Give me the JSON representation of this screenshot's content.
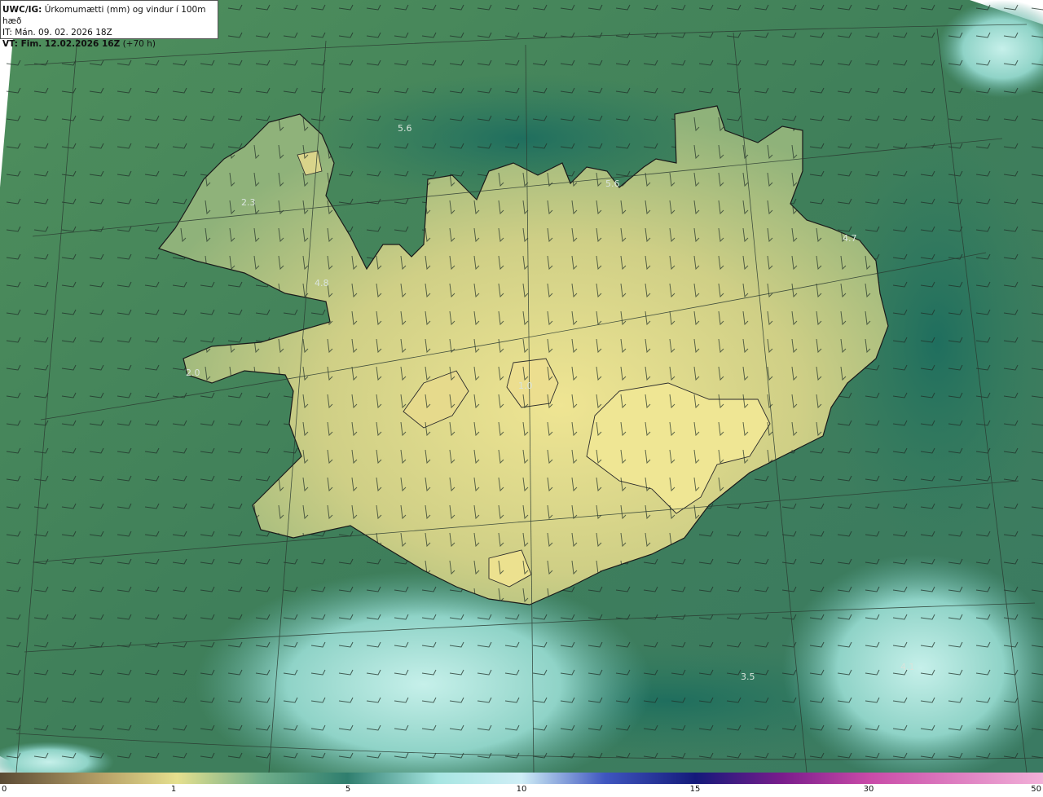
{
  "header": {
    "product": "UWC/IG:",
    "parameter": "Úrkomumætti (mm) og vindur í 100m hæð",
    "initial_time": "IT: Mán. 09. 02. 2026 18Z",
    "valid_prefix": "VT: Fim. 12.02.2026 16Z",
    "valid_suffix": "(+70 h)"
  },
  "map_labels": [
    {
      "id": "label-5-6-north",
      "text": "5.6"
    },
    {
      "id": "label-5-6-northeast",
      "text": "5.6"
    },
    {
      "id": "label-2-3",
      "text": "2.3"
    },
    {
      "id": "label-4-7",
      "text": "4.7"
    },
    {
      "id": "label-4-8",
      "text": "4.8"
    },
    {
      "id": "label-2-0",
      "text": "2.0"
    },
    {
      "id": "label-1-0",
      "text": "1.0"
    },
    {
      "id": "label-3-5",
      "text": "3.5"
    },
    {
      "id": "label-4-1",
      "text": "4.1"
    }
  ],
  "colorbar": {
    "ticks": [
      "0",
      "1",
      "5",
      "10",
      "15",
      "30",
      "50"
    ],
    "colors": [
      "#5a4a34",
      "#b8a268",
      "#e5e08e",
      "#6fae8a",
      "#2f7e6e",
      "#a7e6e2",
      "#cfeef6",
      "#3f56c0",
      "#141a7a",
      "#7a1c8c",
      "#c94aa8",
      "#f2b0d8"
    ]
  },
  "palette": {
    "sea_dark": "#2f6f55",
    "sea_mid": "#4a8a62",
    "land_light": "#e7df92",
    "cyan_plume": "#a9e3dc"
  }
}
